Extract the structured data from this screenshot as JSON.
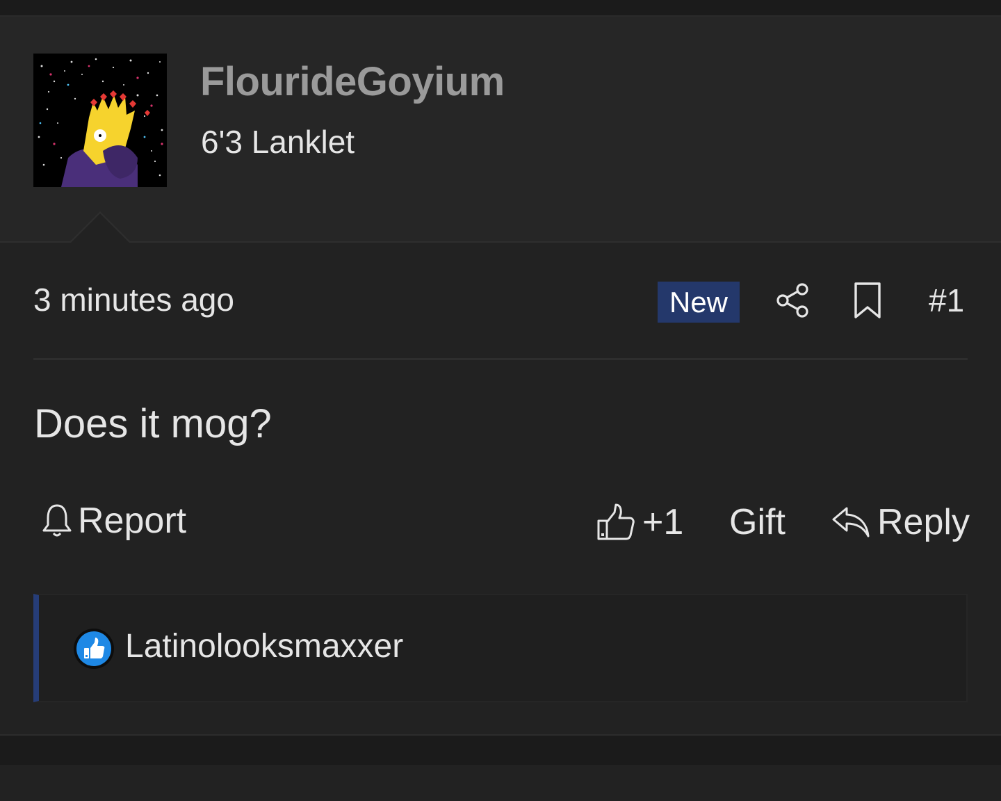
{
  "post": {
    "username": "FlourideGoyium",
    "user_title": "6'3 Lanklet",
    "timestamp": "3 minutes ago",
    "badge": "New",
    "post_number": "#1",
    "message": "Does it mog?"
  },
  "actions": {
    "report_label": "Report",
    "like_label": "+1",
    "gift_label": "Gift",
    "reply_label": "Reply"
  },
  "reactions": {
    "users": [
      "Latinolooksmaxxer"
    ],
    "icon": "thumbs-up-reaction-icon"
  },
  "icons": {
    "share": "share-icon",
    "bookmark": "bookmark-icon",
    "report": "bell-icon",
    "like": "thumbs-up-icon",
    "reply": "reply-arrow-icon"
  },
  "colors": {
    "background": "#1b1b1b",
    "post_background": "#222222",
    "header_background": "#262626",
    "username": "#9a9a9a",
    "text": "#e6e6e6",
    "badge_background": "#24386b",
    "reaction_accent": "#263d78",
    "reaction_icon": "#1e88e5"
  }
}
